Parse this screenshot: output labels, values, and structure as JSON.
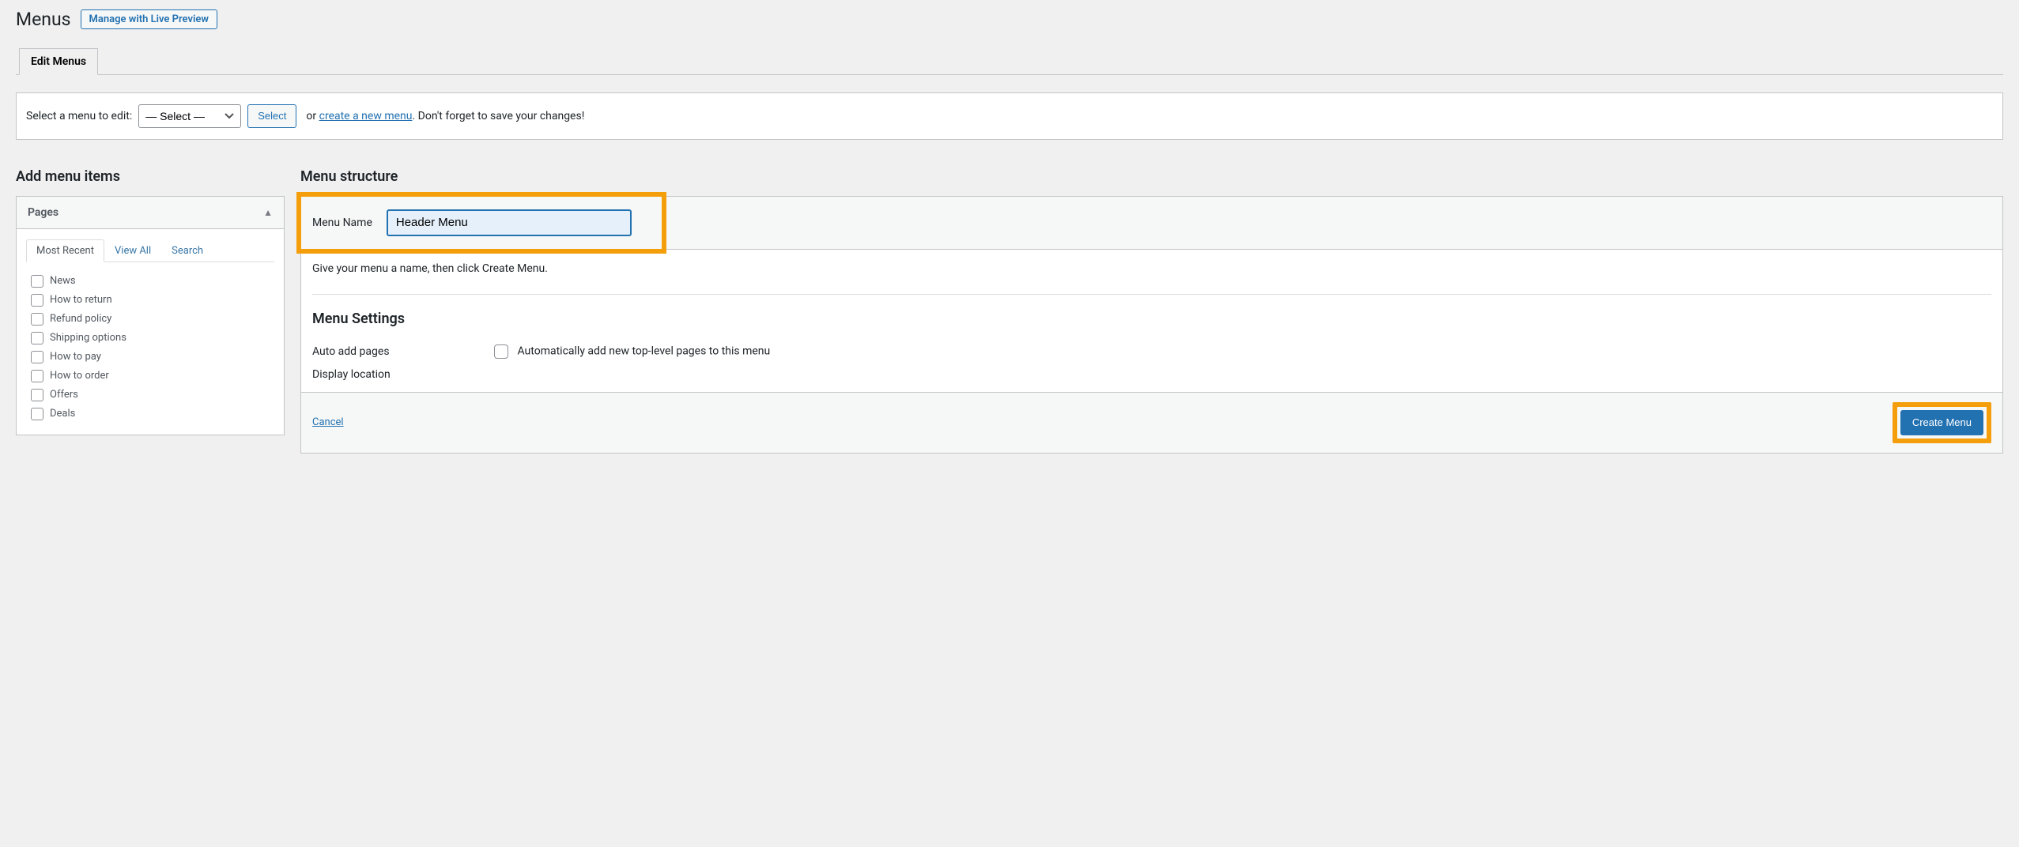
{
  "header": {
    "title": "Menus",
    "live_preview_label": "Manage with Live Preview"
  },
  "tabs": {
    "edit_menus": "Edit Menus"
  },
  "selector": {
    "label": "Select a menu to edit:",
    "option_default": "— Select —",
    "select_button": "Select",
    "or": "or",
    "create_link": "create a new menu",
    "trailing": ". Don't forget to save your changes!"
  },
  "left": {
    "heading": "Add menu items",
    "metabox_title": "Pages",
    "inner_tabs": {
      "recent": "Most Recent",
      "view_all": "View All",
      "search": "Search"
    },
    "pages": [
      "News",
      "How to return",
      "Refund policy",
      "Shipping options",
      "How to pay",
      "How to order",
      "Offers",
      "Deals"
    ]
  },
  "right": {
    "heading": "Menu structure",
    "menu_name_label": "Menu Name",
    "menu_name_value": "Header Menu",
    "instruction": "Give your menu a name, then click Create Menu.",
    "settings_heading": "Menu Settings",
    "auto_add_label": "Auto add pages",
    "auto_add_checkbox": "Automatically add new top-level pages to this menu",
    "display_location_label": "Display location",
    "cancel": "Cancel",
    "create_button": "Create Menu"
  }
}
